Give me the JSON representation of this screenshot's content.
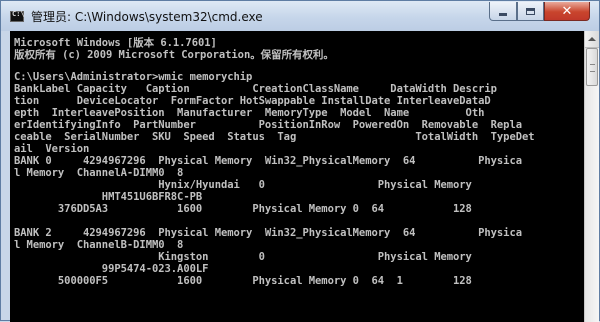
{
  "window": {
    "title": "管理员: C:\\Windows\\system32\\cmd.exe",
    "icon": "console-icon",
    "icon_text": "C:\\",
    "close_glyph": "✕"
  },
  "console": {
    "lines": [
      "Microsoft Windows [版本 6.1.7601]",
      "版权所有 (c) 2009 Microsoft Corporation。保留所有权利。",
      "",
      "C:\\Users\\Administrator>wmic memorychip",
      "BankLabel Capacity   Caption          CreationClassName     DataWidth Descrip",
      "tion      DeviceLocator  FormFactor HotSwappable InstallDate InterleaveDataD",
      "epth  InterleavePosition  Manufacturer  MemoryType  Model  Name         Oth",
      "erIdentifyingInfo  PartNumber          PositionInRow  PoweredOn  Removable  Repla",
      "ceable  SerialNumber  SKU  Speed  Status  Tag                   TotalWidth  TypeDet",
      "ail  Version",
      "BANK 0     4294967296  Physical Memory  Win32_PhysicalMemory  64          Physica",
      "l Memory  ChannelA-DIMM0  8",
      "                       Hynix/Hyundai   0                  Physical Memory",
      "              HMT451U6BFR8C-PB",
      "       376DD5A3           1600        Physical Memory 0  64           128",
      "",
      "BANK 2     4294967296  Physical Memory  Win32_PhysicalMemory  64          Physica",
      "l Memory  ChannelB-DIMM0  8",
      "                       Kingston        0                  Physical Memory",
      "              99P5474-023.A00LF",
      "       500000F5           1600        Physical Memory 0  64  1        128"
    ]
  }
}
